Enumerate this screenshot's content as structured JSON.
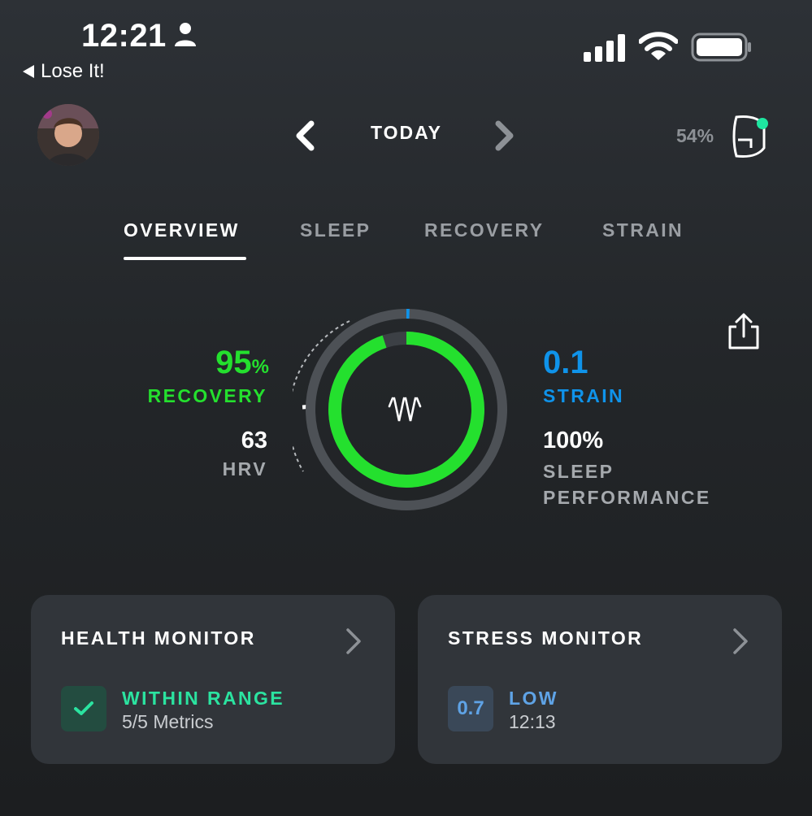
{
  "status_bar": {
    "time": "12:21",
    "back_app": "Lose It!"
  },
  "header": {
    "date_label": "TODAY",
    "device_battery": "54%"
  },
  "tabs": [
    {
      "label": "OVERVIEW",
      "active": true
    },
    {
      "label": "SLEEP",
      "active": false
    },
    {
      "label": "RECOVERY",
      "active": false
    },
    {
      "label": "STRAIN",
      "active": false
    }
  ],
  "recovery": {
    "value": "95",
    "unit": "%",
    "label": "RECOVERY",
    "color": "#24e02e",
    "progress": 0.95
  },
  "hrv": {
    "value": "63",
    "label": "HRV"
  },
  "strain": {
    "value": "0.1",
    "label": "STRAIN",
    "color": "#0f93ea",
    "progress": 0.005
  },
  "sleep": {
    "value": "100%",
    "label_line1": "SLEEP",
    "label_line2": "PERFORMANCE"
  },
  "cards": {
    "health": {
      "title": "HEALTH MONITOR",
      "status": "WITHIN RANGE",
      "status_color": "#2be3a0",
      "sub": "5/5 Metrics"
    },
    "stress": {
      "title": "STRESS MONITOR",
      "badge_value": "0.7",
      "status": "LOW",
      "status_color": "#5fa3e6",
      "sub": "12:13"
    }
  },
  "icons": [
    "person-icon",
    "signal-icon",
    "wifi-icon",
    "battery-icon",
    "chevron-left-icon",
    "chevron-right-icon",
    "band-icon",
    "share-icon",
    "whoop-logo-icon",
    "check-icon"
  ]
}
